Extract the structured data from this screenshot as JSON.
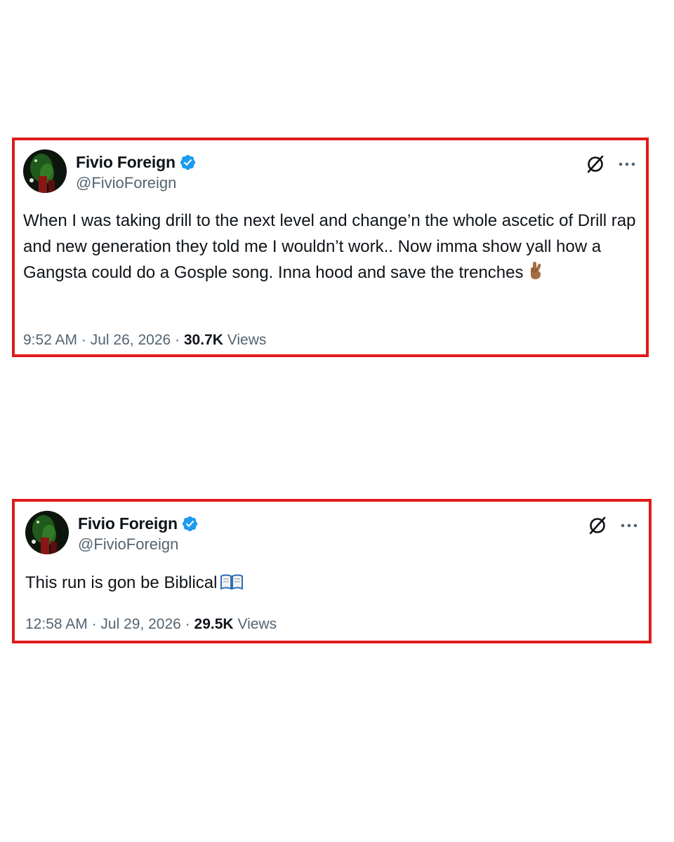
{
  "tweets": [
    {
      "author": {
        "display_name": "Fivio Foreign",
        "handle": "@FivioForeign",
        "verified": true
      },
      "text": "When I was taking drill to the next level and change’n the whole ascetic of Drill rap and new generation they told me I wouldn’t work.. Now imma show yall how a Gangsta could do a Gosple song. Inna hood and save the trenches",
      "emoji": "crossed-fingers-icon",
      "time": "9:52 AM",
      "date": "Jul 26, 2026",
      "separator": "·",
      "views_count": "30.7K",
      "views_label": "Views"
    },
    {
      "author": {
        "display_name": "Fivio Foreign",
        "handle": "@FivioForeign",
        "verified": true
      },
      "text": "This run is gon be Biblical",
      "emoji": "open-book-icon",
      "time": "12:58 AM",
      "date": "Jul 29, 2026",
      "separator": "·",
      "views_count": "29.5K",
      "views_label": "Views"
    }
  ],
  "colors": {
    "highlight_border": "#e01b1b",
    "verified_badge": "#1d9bf0",
    "secondary_text": "#536471",
    "primary_text": "#0f1419"
  }
}
